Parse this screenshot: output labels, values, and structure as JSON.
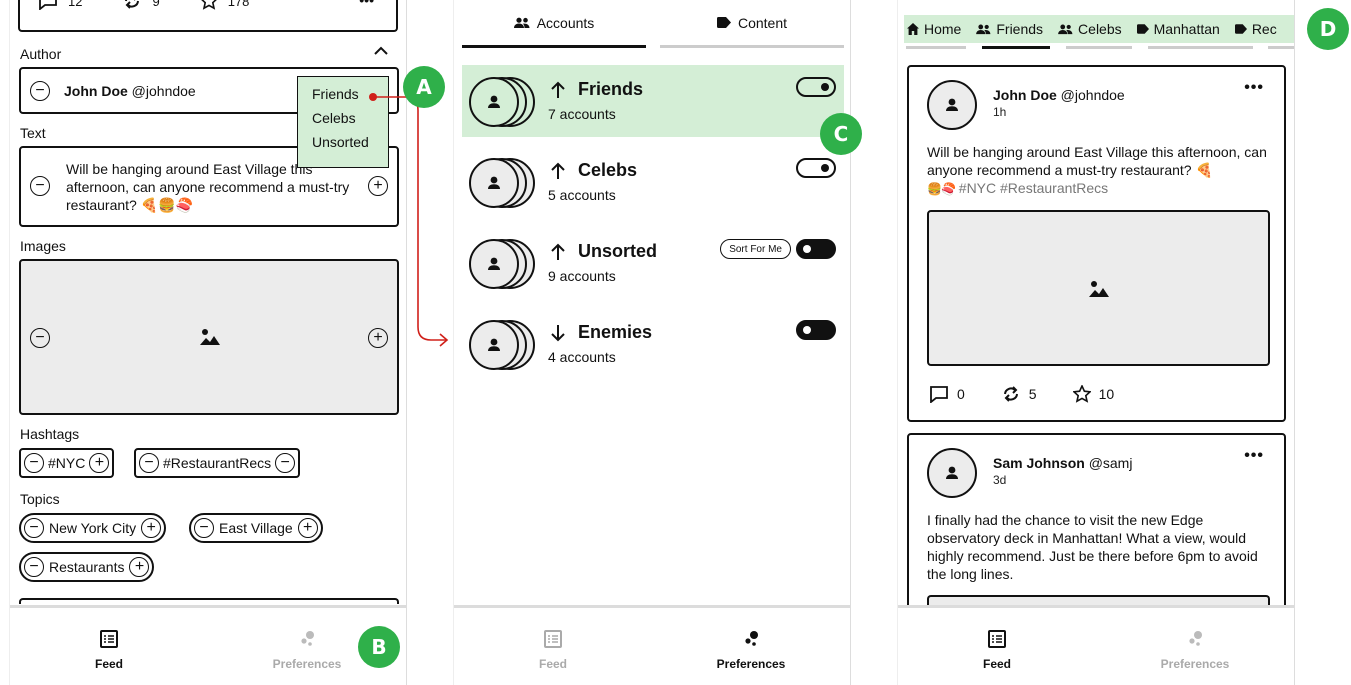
{
  "panel_feed_editor": {
    "top_card": {
      "comments": "12",
      "reposts": "9",
      "stars": "178",
      "more": "•••"
    },
    "author_label": "Author",
    "author_name": "John Doe",
    "author_handle": "@johndoe",
    "dropdown_options": [
      "Friends",
      "Celebs",
      "Unsorted"
    ],
    "text_label": "Text",
    "text_value": "Will be hanging around East Village this afternoon, can anyone recommend a must-try restaurant? 🍕🍔🍣",
    "images_label": "Images",
    "hashtags_label": "Hashtags",
    "hashtags": [
      "#NYC",
      "#RestaurantRecs"
    ],
    "topics_label": "Topics",
    "topics": [
      "New York City",
      "East Village",
      "Restaurants"
    ],
    "nav": {
      "feed": "Feed",
      "preferences": "Preferences"
    }
  },
  "markers": {
    "a": "A",
    "b": "B",
    "c": "C",
    "d": "D"
  },
  "panel_preferences": {
    "tabs": {
      "accounts": "Accounts",
      "content": "Content"
    },
    "groups": [
      {
        "name": "Friends",
        "count": "7 accounts",
        "direction": "up",
        "toggle": "on",
        "highlight": true
      },
      {
        "name": "Celebs",
        "count": "5 accounts",
        "direction": "up",
        "toggle": "on",
        "highlight": false
      },
      {
        "name": "Unsorted",
        "count": "9 accounts",
        "direction": "up",
        "toggle": "off",
        "highlight": false,
        "sort_label": "Sort For Me"
      },
      {
        "name": "Enemies",
        "count": "4 accounts",
        "direction": "down",
        "toggle": "off",
        "highlight": false
      }
    ],
    "nav": {
      "feed": "Feed",
      "preferences": "Preferences"
    }
  },
  "panel_feed": {
    "topnav": [
      "Home",
      "Friends",
      "Celebs",
      "Manhattan",
      "Rec"
    ],
    "posts": [
      {
        "name": "John Doe",
        "handle": "@johndoe",
        "time": "1h",
        "text": "Will be hanging around East Village this afternoon, can anyone recommend a must-try restaurant? 🍕",
        "emoji2": "🍔🍣",
        "tags": "#NYC #RestaurantRecs",
        "comments": "0",
        "reposts": "5",
        "stars": "10"
      },
      {
        "name": "Sam Johnson",
        "handle": "@samj",
        "time": "3d",
        "text": "I finally had the chance to visit the new Edge observatory deck in Manhattan! What a view, would highly recommend. Just be there before 6pm to avoid the long lines."
      }
    ],
    "more": "•••",
    "nav": {
      "feed": "Feed",
      "preferences": "Preferences"
    }
  },
  "colors": {
    "accent_green": "#2fb04a",
    "highlight_green": "#d4eed6",
    "connector_red": "#d0201a"
  }
}
